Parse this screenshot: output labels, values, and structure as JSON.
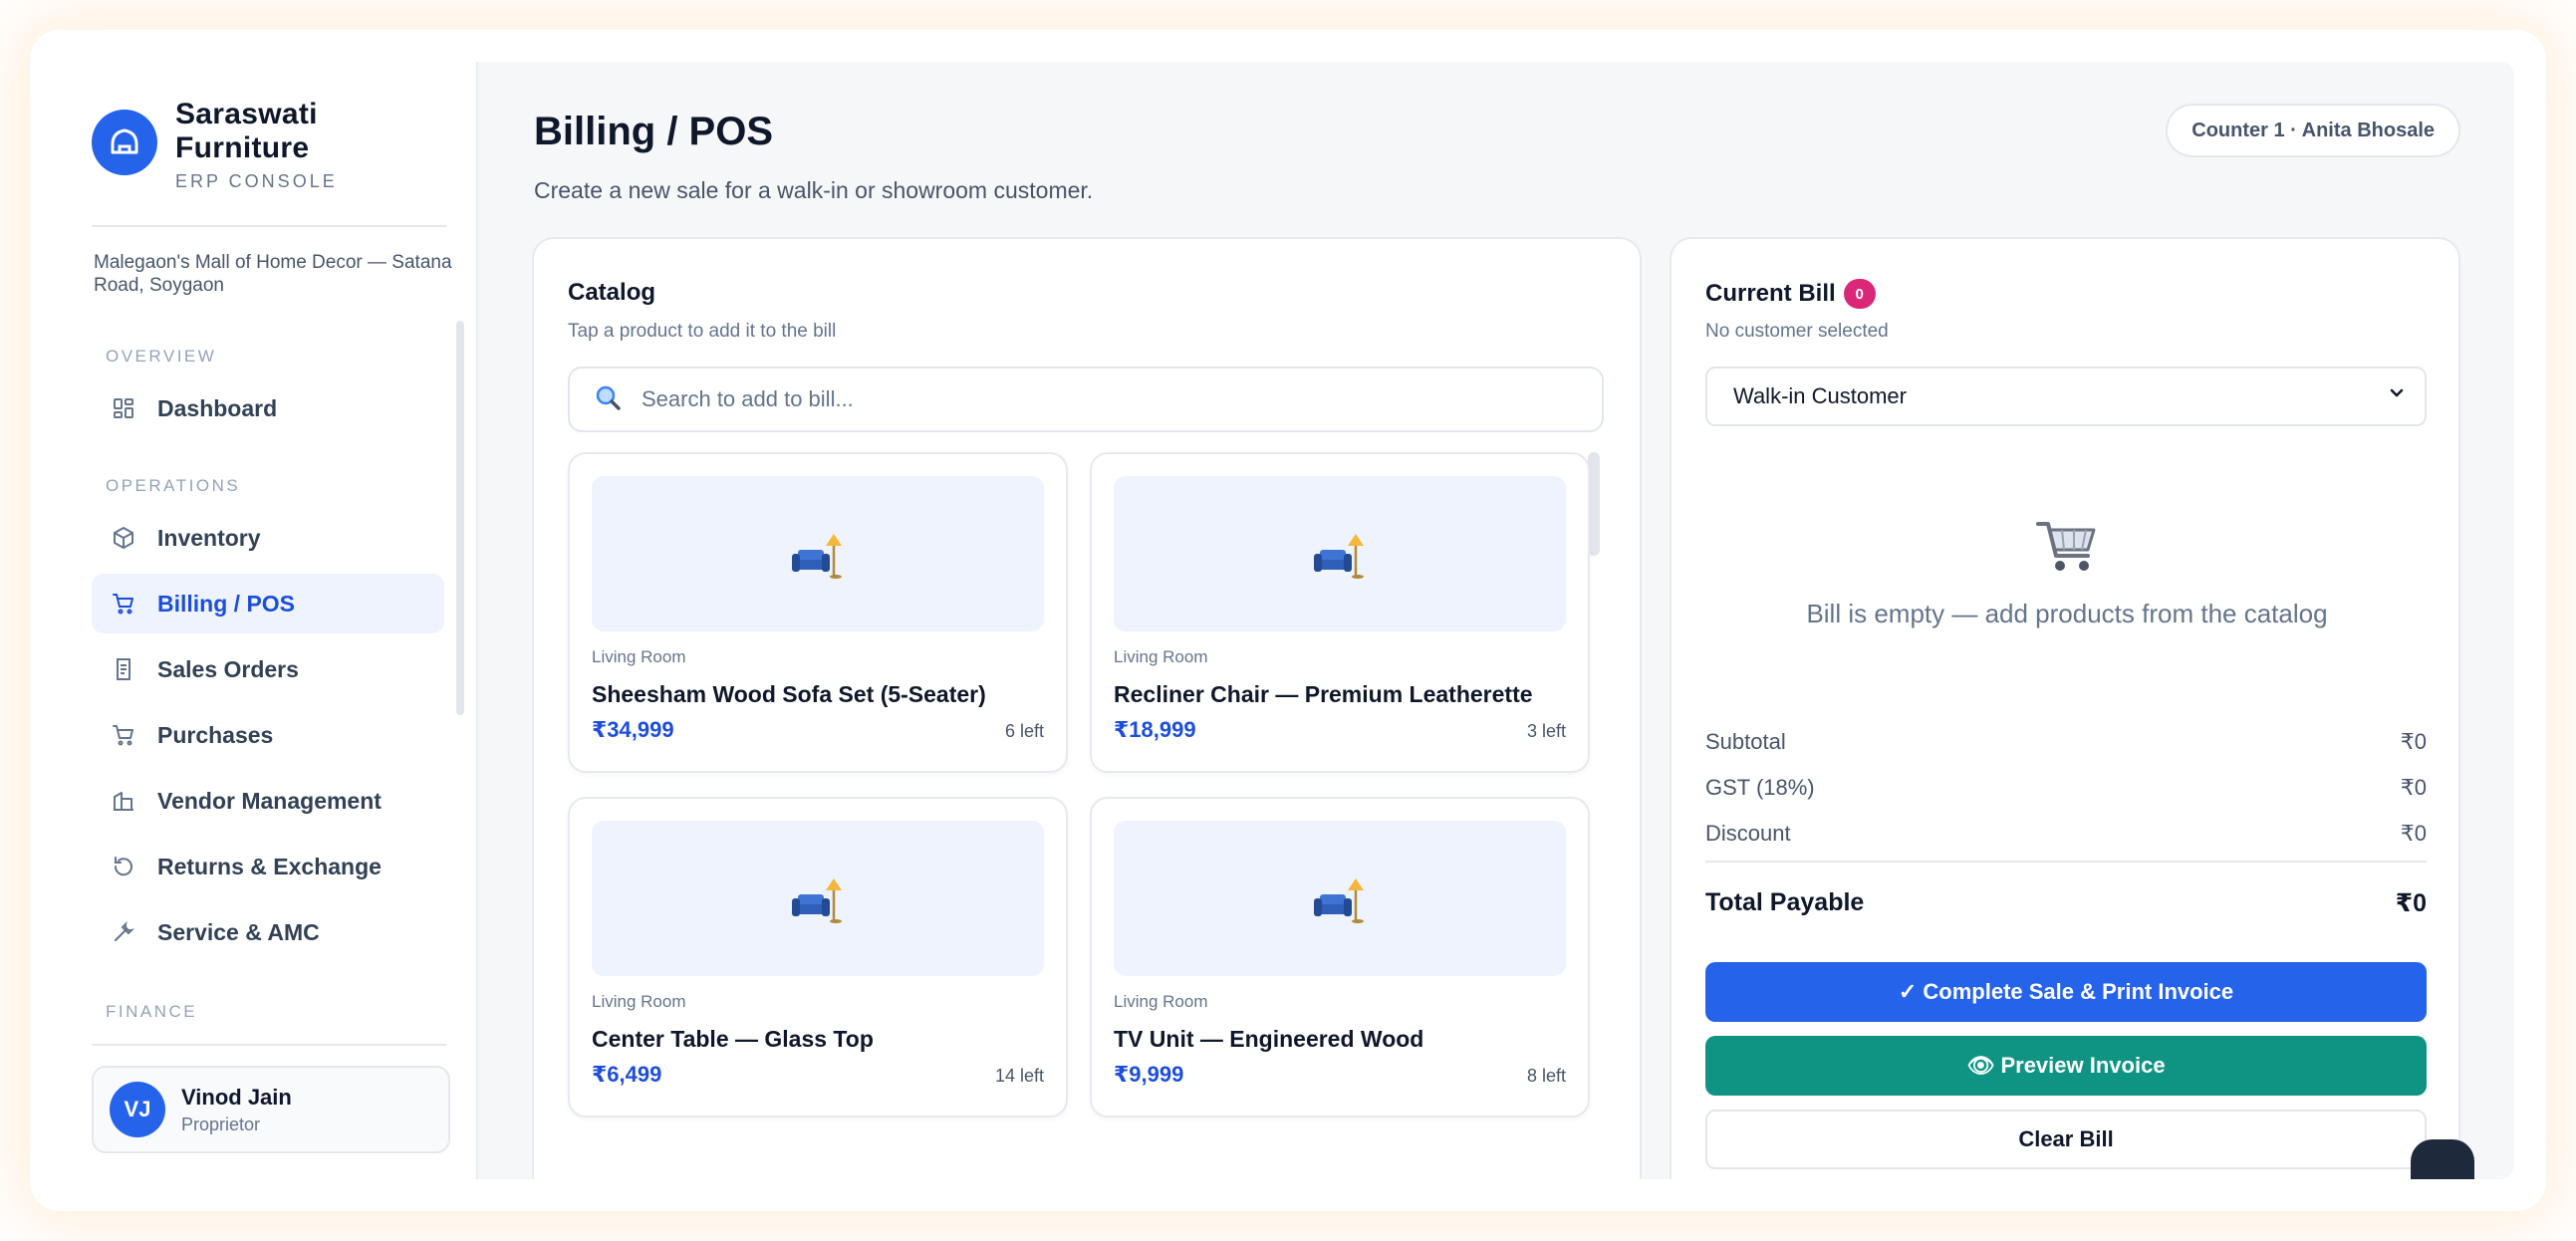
{
  "brand": {
    "name_line1": "Saraswati",
    "name_line2": "Furniture",
    "subtitle": "ERP CONSOLE",
    "store_address": "Malegaon's Mall of Home Decor — Satana Road, Soygaon"
  },
  "nav": {
    "section_overview": "OVERVIEW",
    "section_operations": "OPERATIONS",
    "section_finance": "FINANCE",
    "dashboard": "Dashboard",
    "inventory": "Inventory",
    "billing": "Billing / POS",
    "sales_orders": "Sales Orders",
    "purchases": "Purchases",
    "vendor_management": "Vendor Management",
    "returns": "Returns & Exchange",
    "service": "Service & AMC"
  },
  "user": {
    "initials": "VJ",
    "name": "Vinod Jain",
    "role": "Proprietor"
  },
  "header": {
    "title": "Billing / POS",
    "subtitle": "Create a new sale for a walk-in or showroom customer.",
    "counter": "Counter 1 · Anita Bhosale"
  },
  "catalog": {
    "title": "Catalog",
    "subtitle": "Tap a product to add it to the bill",
    "search_placeholder": "Search to add to bill...",
    "products": [
      {
        "category": "Living Room",
        "name": "Sheesham Wood Sofa Set (5-Seater)",
        "price": "₹34,999",
        "stock": "6 left"
      },
      {
        "category": "Living Room",
        "name": "Recliner Chair — Premium Leatherette",
        "price": "₹18,999",
        "stock": "3 left"
      },
      {
        "category": "Living Room",
        "name": "Center Table — Glass Top",
        "price": "₹6,499",
        "stock": "14 left"
      },
      {
        "category": "Living Room",
        "name": "TV Unit — Engineered Wood",
        "price": "₹9,999",
        "stock": "8 left"
      }
    ]
  },
  "bill": {
    "title": "Current Bill",
    "count": "0",
    "customer_status": "No customer selected",
    "customer_selected": "Walk-in Customer",
    "empty_message": "Bill is empty — add products from the catalog",
    "subtotal_label": "Subtotal",
    "subtotal_value": "₹0",
    "gst_label": "GST (18%)",
    "gst_value": "₹0",
    "discount_label": "Discount",
    "discount_value": "₹0",
    "total_label": "Total Payable",
    "total_value": "₹0",
    "complete_button": "✓ Complete Sale & Print Invoice",
    "preview_button": "👁 Preview Invoice",
    "clear_button": "Clear Bill"
  },
  "colors": {
    "accent": "#2563eb",
    "teal": "#0f9484",
    "badge": "#db2777"
  }
}
